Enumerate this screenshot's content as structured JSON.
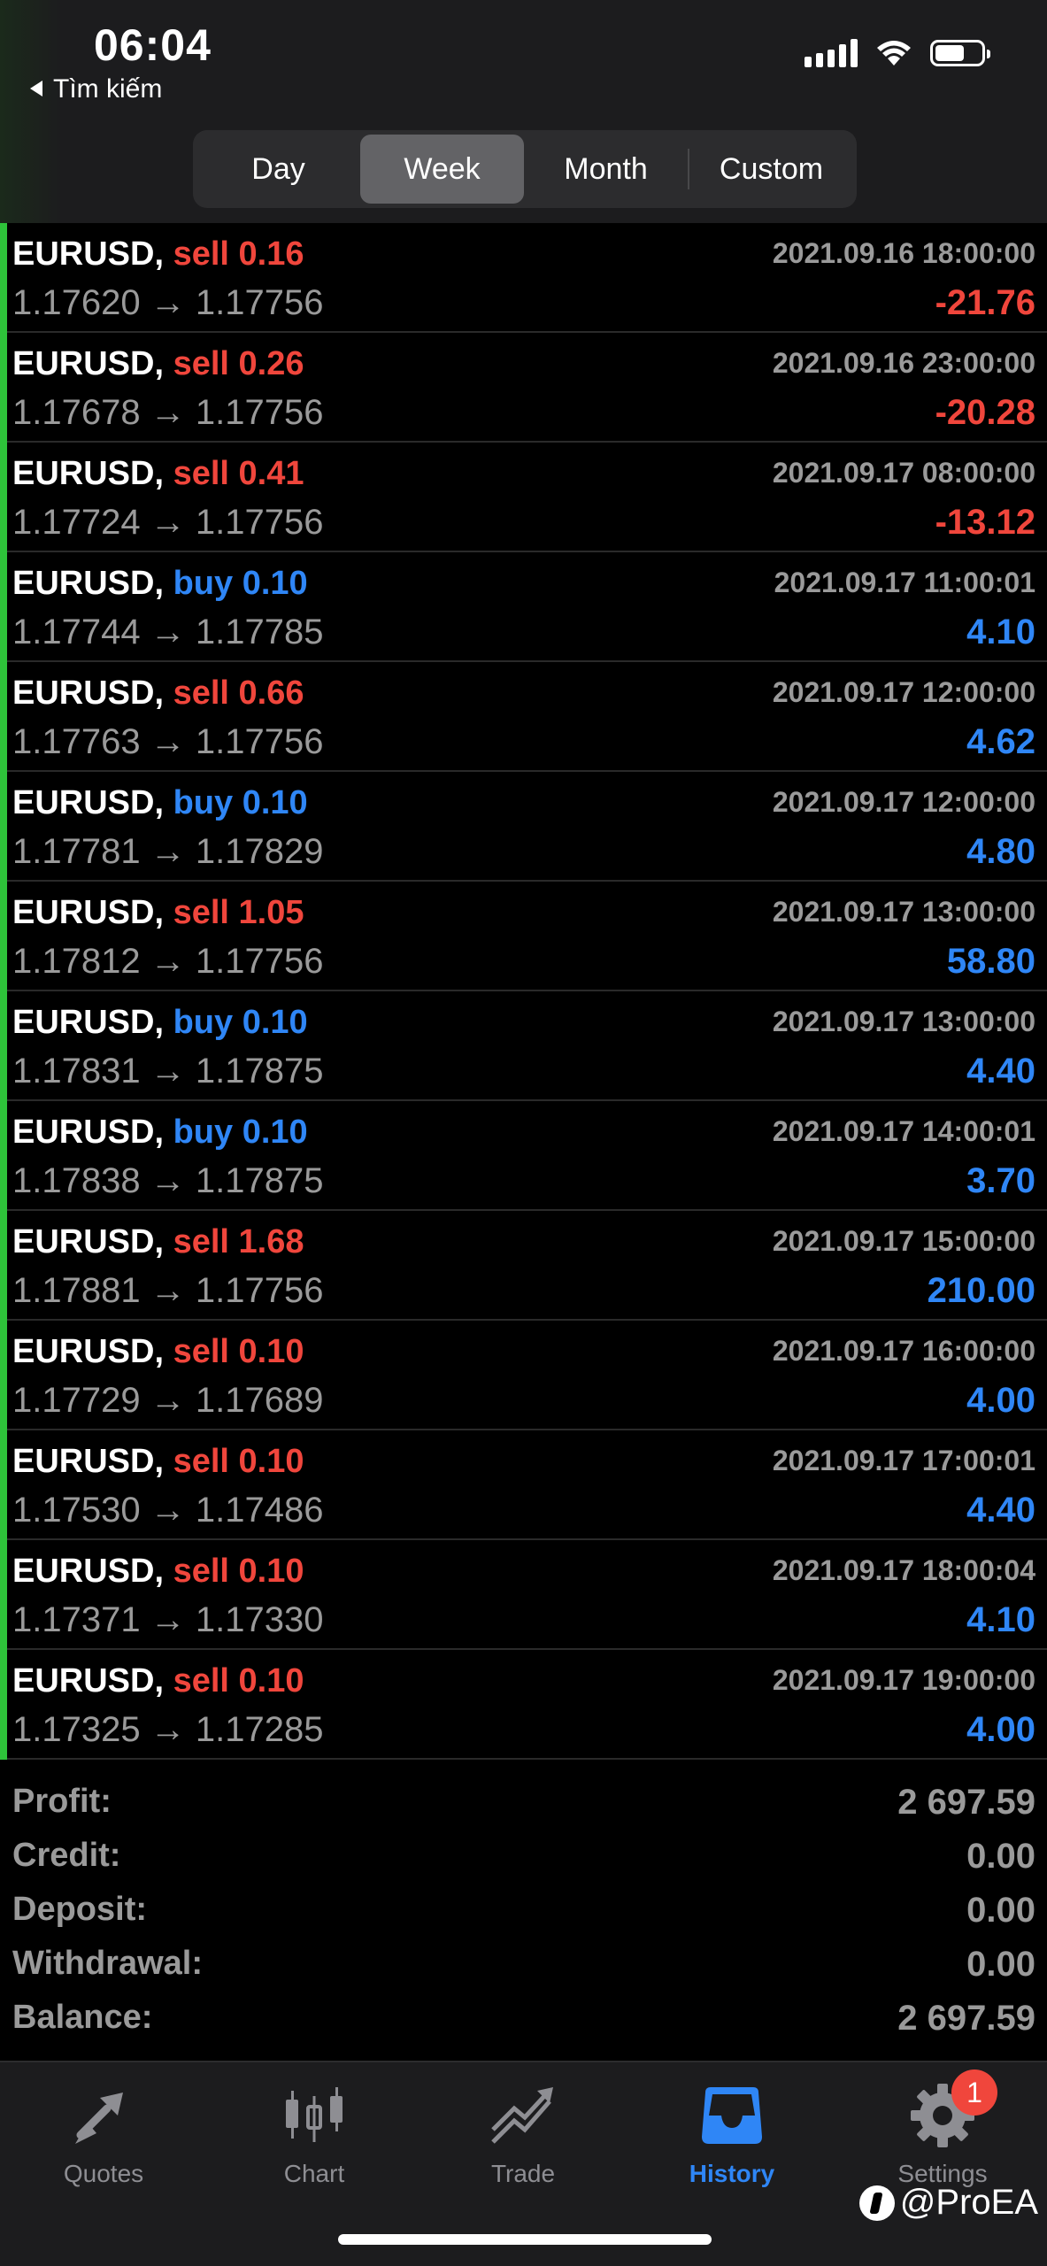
{
  "status_bar": {
    "time": "06:04",
    "back_label": "Tìm kiếm"
  },
  "segment": {
    "tabs": [
      "Day",
      "Week",
      "Month",
      "Custom"
    ],
    "active": "Week"
  },
  "deals": [
    {
      "symbol": "EURUSD,",
      "side": "sell",
      "volume": "0.16",
      "datetime": "2021.09.16 18:00:00",
      "open": "1.17620",
      "close": "1.17756",
      "profit": "-21.76"
    },
    {
      "symbol": "EURUSD,",
      "side": "sell",
      "volume": "0.26",
      "datetime": "2021.09.16 23:00:00",
      "open": "1.17678",
      "close": "1.17756",
      "profit": "-20.28"
    },
    {
      "symbol": "EURUSD,",
      "side": "sell",
      "volume": "0.41",
      "datetime": "2021.09.17 08:00:00",
      "open": "1.17724",
      "close": "1.17756",
      "profit": "-13.12"
    },
    {
      "symbol": "EURUSD,",
      "side": "buy",
      "volume": "0.10",
      "datetime": "2021.09.17 11:00:01",
      "open": "1.17744",
      "close": "1.17785",
      "profit": "4.10"
    },
    {
      "symbol": "EURUSD,",
      "side": "sell",
      "volume": "0.66",
      "datetime": "2021.09.17 12:00:00",
      "open": "1.17763",
      "close": "1.17756",
      "profit": "4.62"
    },
    {
      "symbol": "EURUSD,",
      "side": "buy",
      "volume": "0.10",
      "datetime": "2021.09.17 12:00:00",
      "open": "1.17781",
      "close": "1.17829",
      "profit": "4.80"
    },
    {
      "symbol": "EURUSD,",
      "side": "sell",
      "volume": "1.05",
      "datetime": "2021.09.17 13:00:00",
      "open": "1.17812",
      "close": "1.17756",
      "profit": "58.80"
    },
    {
      "symbol": "EURUSD,",
      "side": "buy",
      "volume": "0.10",
      "datetime": "2021.09.17 13:00:00",
      "open": "1.17831",
      "close": "1.17875",
      "profit": "4.40"
    },
    {
      "symbol": "EURUSD,",
      "side": "buy",
      "volume": "0.10",
      "datetime": "2021.09.17 14:00:01",
      "open": "1.17838",
      "close": "1.17875",
      "profit": "3.70"
    },
    {
      "symbol": "EURUSD,",
      "side": "sell",
      "volume": "1.68",
      "datetime": "2021.09.17 15:00:00",
      "open": "1.17881",
      "close": "1.17756",
      "profit": "210.00"
    },
    {
      "symbol": "EURUSD,",
      "side": "sell",
      "volume": "0.10",
      "datetime": "2021.09.17 16:00:00",
      "open": "1.17729",
      "close": "1.17689",
      "profit": "4.00"
    },
    {
      "symbol": "EURUSD,",
      "side": "sell",
      "volume": "0.10",
      "datetime": "2021.09.17 17:00:01",
      "open": "1.17530",
      "close": "1.17486",
      "profit": "4.40"
    },
    {
      "symbol": "EURUSD,",
      "side": "sell",
      "volume": "0.10",
      "datetime": "2021.09.17 18:00:04",
      "open": "1.17371",
      "close": "1.17330",
      "profit": "4.10"
    },
    {
      "symbol": "EURUSD,",
      "side": "sell",
      "volume": "0.10",
      "datetime": "2021.09.17 19:00:00",
      "open": "1.17325",
      "close": "1.17285",
      "profit": "4.00"
    }
  ],
  "arrow": "→",
  "summary": {
    "profit_label": "Profit:",
    "profit": "2 697.59",
    "credit_label": "Credit:",
    "credit": "0.00",
    "deposit_label": "Deposit:",
    "deposit": "0.00",
    "withdrawal_label": "Withdrawal:",
    "withdrawal": "0.00",
    "balance_label": "Balance:",
    "balance": "2 697.59"
  },
  "tabbar": {
    "quotes": "Quotes",
    "chart": "Chart",
    "trade": "Trade",
    "history": "History",
    "settings": "Settings",
    "settings_badge": "1",
    "active": "History"
  },
  "watermark": "@ProEA",
  "colors": {
    "sell": "#f0463c",
    "buy": "#2f86f6",
    "positive": "#2f86f6",
    "negative": "#f0463c",
    "row_bar": "#2ec33a",
    "active_tab": "#2f86f6"
  }
}
